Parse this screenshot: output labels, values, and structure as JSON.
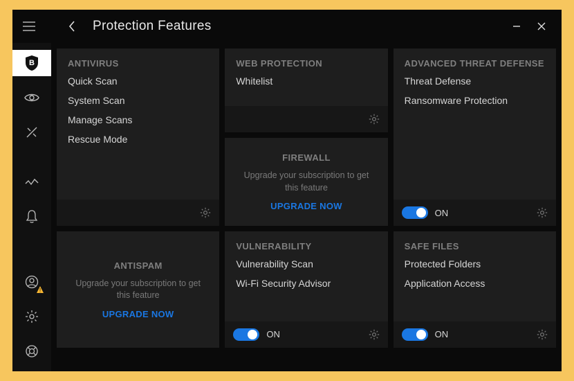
{
  "title": "Protection Features",
  "window": {
    "minimize": "–",
    "close": "×"
  },
  "sidebar": [
    {
      "name": "shield-b",
      "active": true
    },
    {
      "name": "privacy-eye",
      "active": false
    },
    {
      "name": "tools",
      "active": false
    },
    {
      "name": "activity",
      "active": false
    },
    {
      "name": "notifications",
      "active": false
    },
    {
      "name": "account",
      "active": false,
      "alert": true
    },
    {
      "name": "settings",
      "active": false
    },
    {
      "name": "support",
      "active": false
    }
  ],
  "upgrade_msg": "Upgrade your subscription to get this feature",
  "upgrade_cta": "UPGRADE NOW",
  "toggle_on": "ON",
  "cards": {
    "antivirus": {
      "title": "ANTIVIRUS",
      "items": [
        "Quick Scan",
        "System Scan",
        "Manage Scans",
        "Rescue Mode"
      ],
      "footer": {
        "gear": true
      }
    },
    "webprot": {
      "title": "WEB PROTECTION",
      "items": [
        "Whitelist"
      ],
      "footer": {
        "gear": true
      }
    },
    "firewall": {
      "title": "FIREWALL",
      "upgrade": true
    },
    "atd": {
      "title": "ADVANCED THREAT DEFENSE",
      "items": [
        "Threat Defense",
        "Ransomware Protection"
      ],
      "footer": {
        "toggle": true,
        "gear": true
      }
    },
    "antispam": {
      "title": "ANTISPAM",
      "upgrade": true
    },
    "vuln": {
      "title": "VULNERABILITY",
      "items": [
        "Vulnerability Scan",
        "Wi-Fi Security Advisor"
      ],
      "footer": {
        "toggle": true,
        "gear": true
      }
    },
    "safefiles": {
      "title": "SAFE FILES",
      "items": [
        "Protected Folders",
        "Application Access"
      ],
      "footer": {
        "toggle": true,
        "gear": true
      }
    }
  }
}
